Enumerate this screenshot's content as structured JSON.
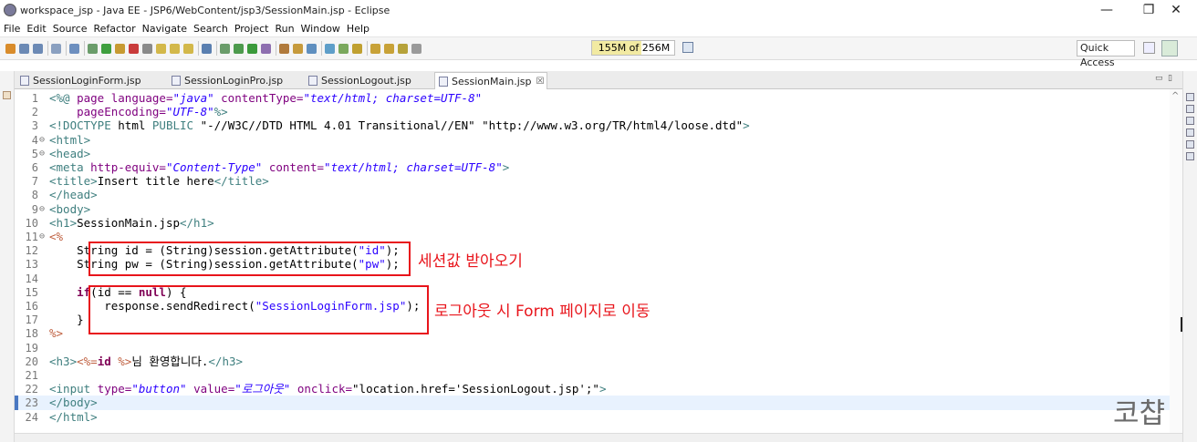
{
  "window": {
    "title": "workspace_jsp - Java EE - JSP6/WebContent/jsp3/SessionMain.jsp - Eclipse",
    "minimize": "—",
    "maximize": "❐",
    "close": "✕"
  },
  "menu": [
    "File",
    "Edit",
    "Source",
    "Refactor",
    "Navigate",
    "Search",
    "Project",
    "Run",
    "Window",
    "Help"
  ],
  "toolbar": {
    "heap_status": "155M of 256M",
    "heap_used_fraction": 0.6,
    "quick_access": "Quick Access"
  },
  "tabs": [
    {
      "label": "SessionLoginForm.jsp",
      "active": false
    },
    {
      "label": "SessionLoginPro.jsp",
      "active": false
    },
    {
      "label": "SessionLogout.jsp",
      "active": false
    },
    {
      "label": "SessionMain.jsp",
      "active": true,
      "close": "☒"
    }
  ],
  "tabbar_controls": {
    "minimize": "▭",
    "maximize": "▯"
  },
  "editor": {
    "current_line": 23,
    "lines": [
      {
        "n": "1",
        "f": "",
        "segs": [
          [
            "t-tag",
            "<%@ "
          ],
          [
            "t-attr",
            "page language="
          ],
          [
            "t-str",
            "\"java\""
          ],
          [
            "t-attr",
            " contentType="
          ],
          [
            "t-str",
            "\"text/html; charset=UTF-8\""
          ]
        ]
      },
      {
        "n": "2",
        "f": "",
        "segs": [
          [
            "t-attr",
            "    pageEncoding="
          ],
          [
            "t-str",
            "\"UTF-8\""
          ],
          [
            "t-tag",
            "%>"
          ]
        ]
      },
      {
        "n": "3",
        "f": "",
        "segs": [
          [
            "t-tag",
            "<!DOCTYPE "
          ],
          [
            "t-doc",
            "html "
          ],
          [
            "t-tag",
            "PUBLIC "
          ],
          [
            "t-doc",
            "\"-//W3C//DTD HTML 4.01 Transitional//EN\" \"http://www.w3.org/TR/html4/loose.dtd\""
          ],
          [
            "t-tag",
            ">"
          ]
        ]
      },
      {
        "n": "4",
        "f": "⊖",
        "segs": [
          [
            "t-tag",
            "<html>"
          ]
        ]
      },
      {
        "n": "5",
        "f": "⊖",
        "segs": [
          [
            "t-tag",
            "<head>"
          ]
        ]
      },
      {
        "n": "6",
        "f": "",
        "segs": [
          [
            "t-tag",
            "<meta "
          ],
          [
            "t-attr",
            "http-equiv="
          ],
          [
            "t-str",
            "\"Content-Type\""
          ],
          [
            "t-attr",
            " content="
          ],
          [
            "t-str",
            "\"text/html; charset=UTF-8\""
          ],
          [
            "t-tag",
            ">"
          ]
        ]
      },
      {
        "n": "7",
        "f": "",
        "segs": [
          [
            "t-tag",
            "<title>"
          ],
          [
            "t-txt",
            "Insert title here"
          ],
          [
            "t-tag",
            "</title>"
          ]
        ]
      },
      {
        "n": "8",
        "f": "",
        "segs": [
          [
            "t-tag",
            "</head>"
          ]
        ]
      },
      {
        "n": "9",
        "f": "⊖",
        "segs": [
          [
            "t-tag",
            "<body>"
          ]
        ]
      },
      {
        "n": "10",
        "f": "",
        "segs": [
          [
            "t-tag",
            "<h1>"
          ],
          [
            "t-txt",
            "SessionMain.jsp"
          ],
          [
            "t-tag",
            "</h1>"
          ]
        ]
      },
      {
        "n": "11",
        "f": "⊖",
        "segs": [
          [
            "t-jsp",
            "<%"
          ]
        ]
      },
      {
        "n": "12",
        "f": "",
        "segs": [
          [
            "t-plain",
            "    String id = (String)session.getAttribute("
          ],
          [
            "t-jstr",
            "\"id\""
          ],
          [
            "t-plain",
            ");"
          ]
        ]
      },
      {
        "n": "13",
        "f": "",
        "segs": [
          [
            "t-plain",
            "    String pw = (String)session.getAttribute("
          ],
          [
            "t-jstr",
            "\"pw\""
          ],
          [
            "t-plain",
            ");"
          ]
        ]
      },
      {
        "n": "14",
        "f": "",
        "segs": []
      },
      {
        "n": "15",
        "f": "",
        "segs": [
          [
            "t-plain",
            "    "
          ],
          [
            "t-kw",
            "if"
          ],
          [
            "t-plain",
            "(id == "
          ],
          [
            "t-kw",
            "null"
          ],
          [
            "t-plain",
            ") {"
          ]
        ]
      },
      {
        "n": "16",
        "f": "",
        "segs": [
          [
            "t-plain",
            "        response.sendRedirect("
          ],
          [
            "t-jstr",
            "\"SessionLoginForm.jsp\""
          ],
          [
            "t-plain",
            ");"
          ]
        ]
      },
      {
        "n": "17",
        "f": "",
        "segs": [
          [
            "t-plain",
            "    }"
          ]
        ]
      },
      {
        "n": "18",
        "f": "",
        "segs": [
          [
            "t-jsp",
            "%>"
          ]
        ]
      },
      {
        "n": "19",
        "f": "",
        "segs": []
      },
      {
        "n": "20",
        "f": "",
        "segs": [
          [
            "t-tag",
            "<h3>"
          ],
          [
            "t-jsp",
            "<%="
          ],
          [
            "t-kw",
            "id "
          ],
          [
            "t-jsp",
            "%>"
          ],
          [
            "t-txt",
            "님 환영합니다."
          ],
          [
            "t-tag",
            "</h3>"
          ]
        ]
      },
      {
        "n": "21",
        "f": "",
        "segs": []
      },
      {
        "n": "22",
        "f": "",
        "segs": [
          [
            "t-tag",
            "<input "
          ],
          [
            "t-attr",
            "type="
          ],
          [
            "t-str",
            "\"button\""
          ],
          [
            "t-attr",
            " value="
          ],
          [
            "t-str",
            "\"로그아웃\""
          ],
          [
            "t-attr",
            " onclick="
          ],
          [
            "t-doc",
            "\"location.href='SessionLogout.jsp';\""
          ],
          [
            "t-tag",
            ">"
          ]
        ]
      },
      {
        "n": "23",
        "f": "",
        "segs": [
          [
            "t-tag",
            "</body>"
          ]
        ]
      },
      {
        "n": "24",
        "f": "",
        "segs": [
          [
            "t-tag",
            "</html>"
          ]
        ]
      }
    ]
  },
  "annotations": {
    "note1": "세션값 받아오기",
    "note2": "로그아웃 시 Form 페이지로 이동"
  },
  "watermark": "코챱"
}
